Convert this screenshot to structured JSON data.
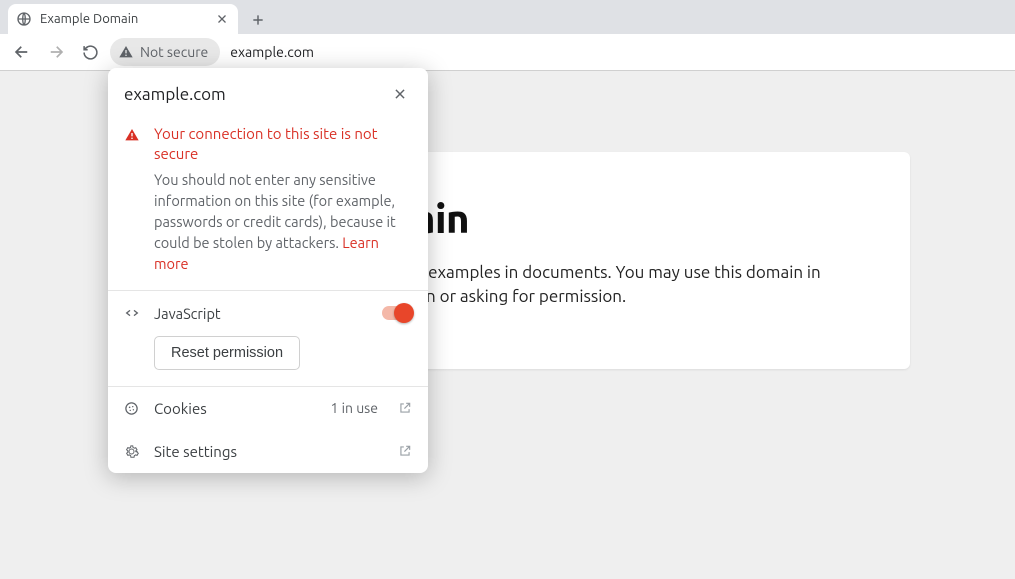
{
  "tab": {
    "title": "Example Domain"
  },
  "toolbar": {
    "not_secure": "Not secure",
    "url": "example.com"
  },
  "page": {
    "heading": "Example Domain",
    "body": "This domain is for use in illustrative examples in documents. You may use this domain in literature without prior coordination or asking for permission."
  },
  "popup": {
    "site": "example.com",
    "warn_title": "Your connection to this site is not secure",
    "warn_body_pre": "You should not enter any sensitive information on this site (for example, passwords or credit cards), because it could be stolen by attackers. ",
    "learn_more": "Learn more",
    "javascript": "JavaScript",
    "reset": "Reset permission",
    "cookies_label": "Cookies",
    "cookies_meta": "1 in use",
    "site_settings": "Site settings"
  }
}
